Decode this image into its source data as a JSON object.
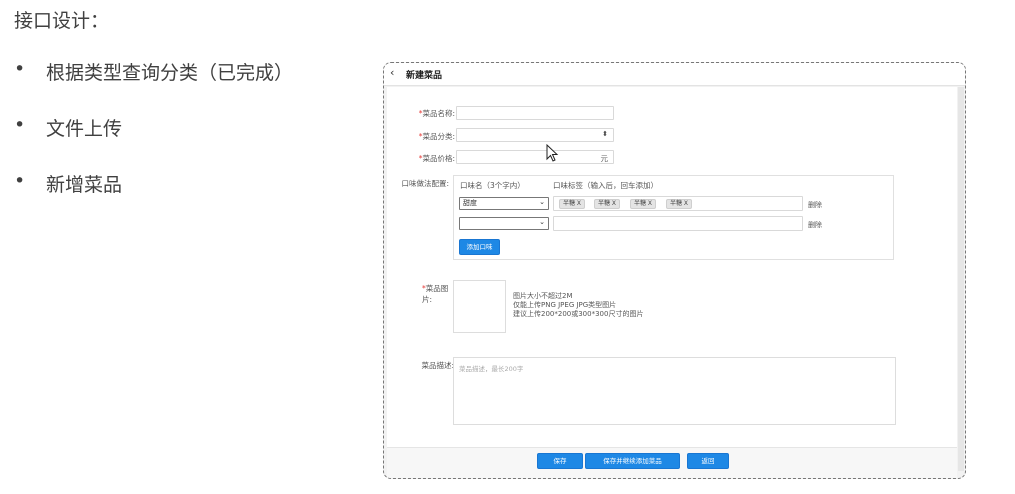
{
  "slide": {
    "title": "接口设计：",
    "bullets": [
      {
        "dot": "•",
        "text": "根据类型查询分类（已完成）"
      },
      {
        "dot": "•",
        "text": "文件上传"
      },
      {
        "dot": "•",
        "text": "新增菜品"
      }
    ]
  },
  "panel": {
    "back_icon": "chevron-left-icon",
    "title": "新建菜品",
    "form": {
      "required_mark": "*",
      "name_label": "菜品名称:",
      "name_value": "",
      "category_label": "菜品分类:",
      "category_value": "",
      "category_arrow": "⬍",
      "price_label": "菜品价格:",
      "price_value": "",
      "price_suffix": "元",
      "flavor_label": "口味做法配置:",
      "flavor_col_name": "口味名（3个字内）",
      "flavor_col_tags": "口味标签（输入后，回车添加）",
      "flavor_rows": [
        {
          "name": "甜度",
          "tags": [
            "半糖 X",
            "半糖 X",
            "半糖 X",
            "半糖 X"
          ],
          "delete": "删除"
        },
        {
          "name": "",
          "tags": [],
          "delete": "删除"
        }
      ],
      "add_flavor_button": "添加口味",
      "image_label_line1": "菜品图",
      "image_label_line2": "片:",
      "image_tips": [
        "图片大小不超过2M",
        "仅能上传PNG JPEG JPG类型图片",
        "建议上传200*200或300*300尺寸的图片"
      ],
      "desc_label": "菜品描述:",
      "desc_placeholder": "菜品描述，最长200字"
    },
    "footer": {
      "save": "保存",
      "save_continue": "保存并继续添加菜品",
      "back": "返回"
    }
  },
  "colors": {
    "primary": "#1e88e5",
    "required": "#e53935"
  }
}
